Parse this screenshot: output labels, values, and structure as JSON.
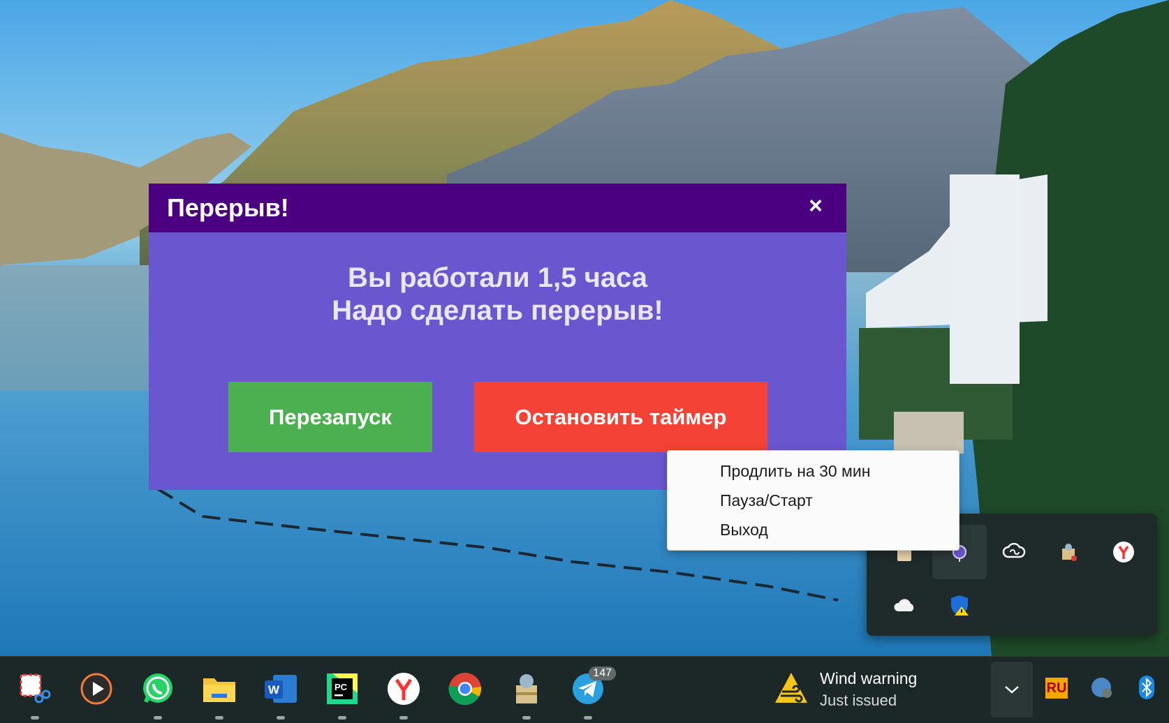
{
  "dialog": {
    "title": "Перерыв!",
    "close_label": "×",
    "message_line1": "Вы работали 1,5 часа",
    "message_line2": "Надо сделать перерыв!",
    "restart_label": "Перезапуск",
    "stop_label": "Остановить таймер",
    "colors": {
      "header": "#4b0082",
      "body": "#6a57cf",
      "restart": "#4caf50",
      "stop": "#f44336"
    }
  },
  "context_menu": {
    "items": [
      "Продлить на 30 мин",
      "Пауза/Старт",
      "Выход"
    ]
  },
  "tray_flyout": {
    "icons": [
      "clipboard-icon",
      "timer-app-icon",
      "creative-cloud-icon",
      "archiver-icon",
      "yandex-browser-icon",
      "onedrive-icon",
      "windows-security-warning-icon"
    ]
  },
  "taskbar": {
    "apps": [
      {
        "name": "snipping-tool-icon"
      },
      {
        "name": "media-player-icon"
      },
      {
        "name": "whatsapp-icon"
      },
      {
        "name": "file-explorer-icon"
      },
      {
        "name": "word-icon"
      },
      {
        "name": "pycharm-icon"
      },
      {
        "name": "yandex-browser-icon"
      },
      {
        "name": "chrome-icon"
      },
      {
        "name": "archiver-icon"
      },
      {
        "name": "telegram-icon",
        "badge": "147"
      }
    ],
    "weather": {
      "title": "Wind warning",
      "subtitle": "Just issued"
    },
    "language": "RU"
  }
}
